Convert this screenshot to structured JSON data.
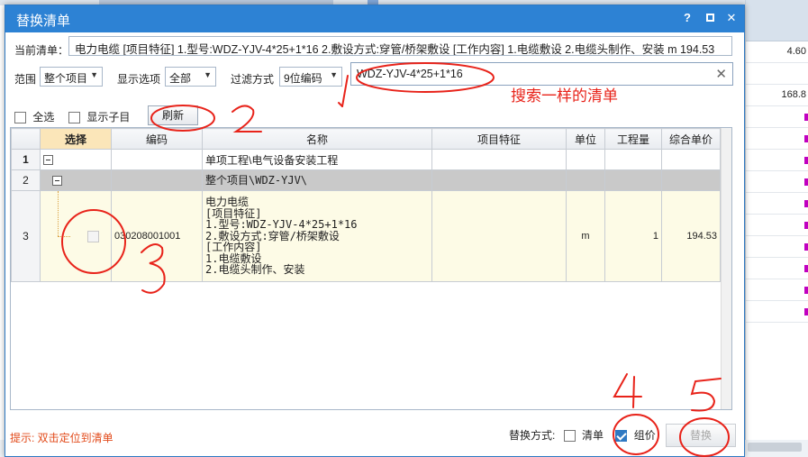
{
  "background": {
    "right_values": [
      "4.60",
      "168.8"
    ]
  },
  "dialog": {
    "title": "替换清单",
    "help_label": "?",
    "close_label": "✕",
    "current_list_label": "当前清单：",
    "current_list_value": "电力电缆   [项目特征]  1.型号:WDZ-YJV-4*25+1*16  2.敷设方式:穿管/桥架敷设  [工作内容]  1.电缆敷设  2.电缆头制作、安装 m 194.53",
    "scope_label": "范围",
    "scope_value": "整个项目",
    "display_label": "显示选项",
    "display_value": "全部",
    "filter_label": "过滤方式",
    "filter_value": "9位编码",
    "search_value": "WDZ-YJV-4*25+1*16",
    "select_all_label": "全选",
    "show_children_label": "显示子目",
    "refresh_label": "刷新",
    "grid": {
      "headers": [
        "选择",
        "编码",
        "名称",
        "项目特征",
        "单位",
        "工程量",
        "综合单价"
      ],
      "rows": [
        {
          "num": "1",
          "name": "单项工程\\电气设备安装工程"
        },
        {
          "num": "2",
          "name": "整个项目\\WDZ-YJV\\"
        },
        {
          "num": "3",
          "code": "030208001001",
          "name_lines": [
            "电力电缆",
            "[项目特征]",
            "1.型号:WDZ-YJV-4*25+1*16",
            "2.敷设方式:穿管/桥架敷设",
            "[工作内容]",
            "1.电缆敷设",
            "2.电缆头制作、安装"
          ],
          "unit": "m",
          "quantity": "1",
          "price": "194.53"
        }
      ]
    },
    "hint": "提示: 双击定位到清单",
    "replace_mode_label": "替换方式:",
    "option_list_label": "清单",
    "option_group_label": "组价",
    "replace_button_label": "替换"
  },
  "annotations": {
    "search_note": "搜索一样的清单",
    "numbers": [
      "1",
      "2",
      "3",
      "4",
      "5"
    ],
    "color": "#e8231a"
  }
}
